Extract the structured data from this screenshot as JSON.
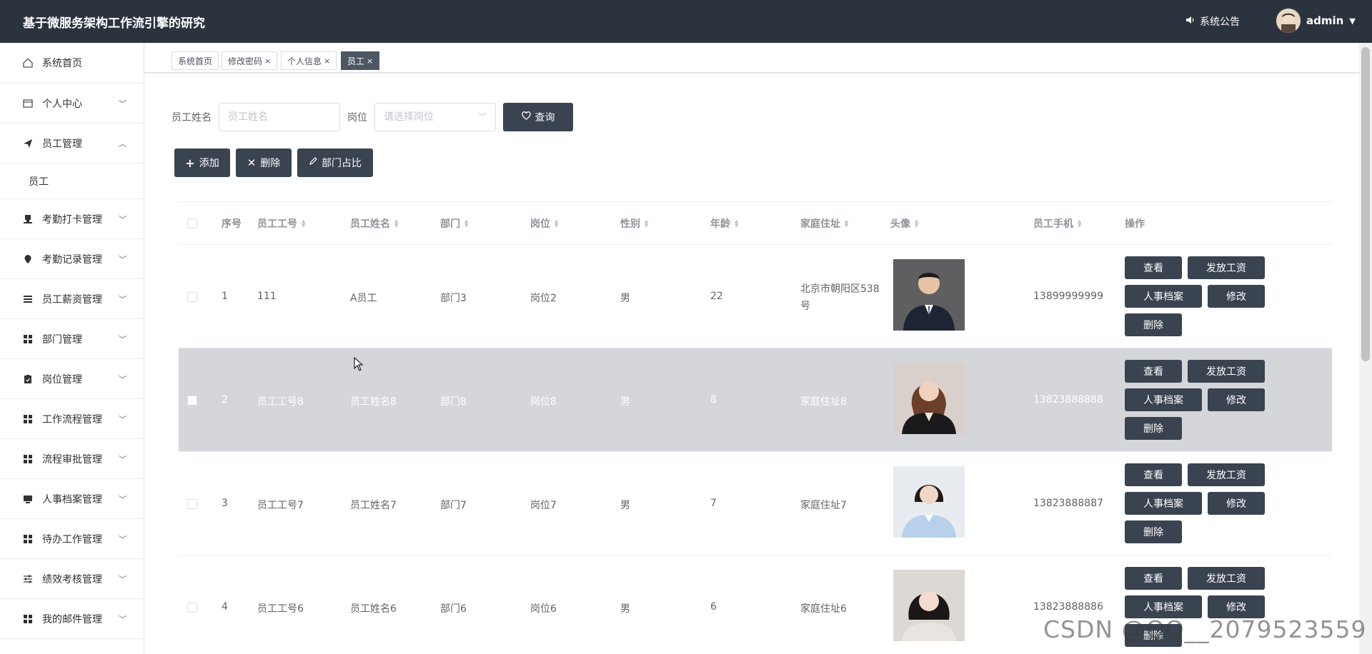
{
  "header": {
    "title": "基于微服务架构工作流引擎的研究",
    "notice": "系统公告",
    "username": "admin"
  },
  "sidebar": {
    "items": [
      {
        "label": "系统首页",
        "icon": "home-icon",
        "expandable": false
      },
      {
        "label": "个人中心",
        "icon": "card-icon",
        "expandable": true
      },
      {
        "label": "员工管理",
        "icon": "send-icon",
        "expandable": true,
        "expanded": true
      },
      {
        "label": "考勤打卡管理",
        "icon": "stamp-icon",
        "expandable": true
      },
      {
        "label": "考勤记录管理",
        "icon": "location-icon",
        "expandable": true
      },
      {
        "label": "员工薪资管理",
        "icon": "list-icon",
        "expandable": true
      },
      {
        "label": "部门管理",
        "icon": "grid-icon",
        "expandable": true
      },
      {
        "label": "岗位管理",
        "icon": "clipboard-icon",
        "expandable": true
      },
      {
        "label": "工作流程管理",
        "icon": "grid-icon",
        "expandable": true
      },
      {
        "label": "流程审批管理",
        "icon": "grid-icon",
        "expandable": true
      },
      {
        "label": "人事档案管理",
        "icon": "monitor-icon",
        "expandable": true
      },
      {
        "label": "待办工作管理",
        "icon": "grid-icon",
        "expandable": true
      },
      {
        "label": "绩效考核管理",
        "icon": "sliders-icon",
        "expandable": true
      },
      {
        "label": "我的邮件管理",
        "icon": "grid-icon",
        "expandable": true
      }
    ],
    "sub_item": "员工"
  },
  "tabs": [
    {
      "label": "系统首页",
      "closable": false
    },
    {
      "label": "修改密码",
      "closable": true
    },
    {
      "label": "个人信息",
      "closable": true
    },
    {
      "label": "员工",
      "closable": true,
      "active": true
    }
  ],
  "search": {
    "name_label": "员工姓名",
    "name_placeholder": "员工姓名",
    "post_label": "岗位",
    "post_placeholder": "请选择岗位",
    "query_button": "查询"
  },
  "actions": {
    "add": "添加",
    "delete": "删除",
    "dept_ratio": "部门占比"
  },
  "table": {
    "headers": [
      "序号",
      "员工工号",
      "员工姓名",
      "部门",
      "岗位",
      "性别",
      "年龄",
      "家庭住址",
      "头像",
      "员工手机",
      "操作"
    ],
    "rows": [
      {
        "index": "1",
        "emp_no": "111",
        "name": "A员工",
        "dept": "部门3",
        "post": "岗位2",
        "gender": "男",
        "age": "22",
        "address": "北京市朝阳区538号",
        "phone": "13899999999"
      },
      {
        "index": "2",
        "emp_no": "员工工号8",
        "name": "员工姓名8",
        "dept": "部门8",
        "post": "岗位8",
        "gender": "男",
        "age": "8",
        "address": "家庭住址8",
        "phone": "13823888888"
      },
      {
        "index": "3",
        "emp_no": "员工工号7",
        "name": "员工姓名7",
        "dept": "部门7",
        "post": "岗位7",
        "gender": "男",
        "age": "7",
        "address": "家庭住址7",
        "phone": "13823888887"
      },
      {
        "index": "4",
        "emp_no": "员工工号6",
        "name": "员工姓名6",
        "dept": "部门6",
        "post": "岗位6",
        "gender": "男",
        "age": "6",
        "address": "家庭住址6",
        "phone": "13823888886"
      }
    ],
    "row_actions": {
      "view": "查看",
      "pay": "发放工资",
      "archive": "人事档案",
      "edit": "修改",
      "delete": "删除"
    }
  },
  "watermark": "CSDN @QQ__2079523559",
  "colors": {
    "header_bg": "#2b333e",
    "button_bg": "#3a4350",
    "highlight_row": "#d4d6da"
  }
}
